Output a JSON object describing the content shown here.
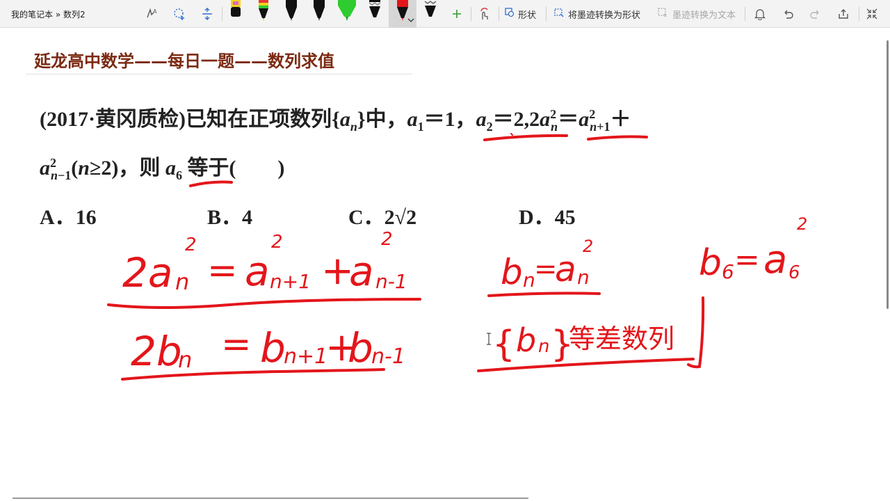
{
  "toolbar": {
    "breadcrumb": "我的笔记本 » 数列2",
    "shape_label": "形状",
    "ink_to_shape_label": "将墨迹转换为形状",
    "ink_to_text_label": "墨迹转换为文本"
  },
  "pens": [
    {
      "name": "pen-black-yellow",
      "color": "#111111",
      "accent": "#f4d21a"
    },
    {
      "name": "pen-multicolor",
      "color": "#111111",
      "accent": "#e53935"
    },
    {
      "name": "pen-black-1",
      "color": "#111111",
      "accent": "#111111"
    },
    {
      "name": "pen-black-2",
      "color": "#111111",
      "accent": "#111111"
    },
    {
      "name": "pen-green",
      "color": "#2ecc2e",
      "accent": "#2ecc2e"
    },
    {
      "name": "pen-pattern",
      "color": "#111111",
      "accent": "#888888"
    },
    {
      "name": "pen-red-selected",
      "color": "#e3161b",
      "accent": "#e3161b"
    },
    {
      "name": "pen-dotted",
      "color": "#111111",
      "accent": "#666666"
    }
  ],
  "page": {
    "title": "延龙高中数学——每日一题——数列求值",
    "problem_source": "(2017·黄冈质检)",
    "problem_line1_text": "已知在正项数列",
    "problem_line2_text": "等于(　　)"
  },
  "choices": [
    {
      "letter": "A．",
      "value": "16"
    },
    {
      "letter": "B．",
      "value": "4"
    },
    {
      "letter": "C．",
      "value": "2√2"
    },
    {
      "letter": "D．",
      "value": "45"
    }
  ],
  "ink_text": {
    "line1": "2an² = an+1² + an-1²",
    "line2": "2bn = bn+1 + bn-1",
    "def": "bn = an²",
    "b6": "b6 = a6²",
    "seq": "{bn} 等差数列"
  },
  "colors": {
    "ink": "#e3161b",
    "title": "#7b2a12",
    "toolbar_bg": "#f3f3f3",
    "accent_icon": "#2f6fd0"
  }
}
